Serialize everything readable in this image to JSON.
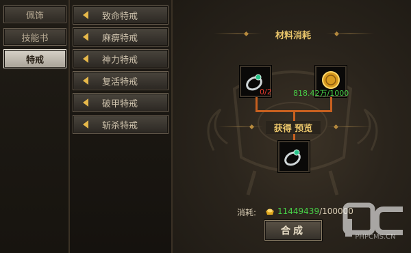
{
  "categories": [
    {
      "label": "佩饰",
      "active": false
    },
    {
      "label": "技能书",
      "active": false
    },
    {
      "label": "特戒",
      "active": true
    }
  ],
  "items": [
    {
      "label": "致命特戒",
      "icon": "arrow-left-icon"
    },
    {
      "label": "麻痹特戒",
      "icon": "arrow-left-icon"
    },
    {
      "label": "神力特戒",
      "icon": "arrow-left-icon"
    },
    {
      "label": "复活特戒",
      "icon": "arrow-left-icon"
    },
    {
      "label": "破甲特戒",
      "icon": "arrow-left-icon"
    },
    {
      "label": "斩杀特戒",
      "icon": "arrow-left-icon"
    }
  ],
  "panel": {
    "materials_title": "材料消耗",
    "preview_title": "获得 预览",
    "material_ring_count": "0/2",
    "material_gold_count": "818.42万/1000",
    "cost_label": "消耗:",
    "cost_current": "11449439",
    "cost_required": "/100000",
    "compose_label": "合成"
  },
  "watermark": {
    "text": "PHPCMS.CN"
  },
  "colors": {
    "accent_gold": "#e8c46a",
    "insufficient_red": "#e33b2e",
    "sufficient_green": "#47d047",
    "connector_orange": "#c8601f"
  }
}
